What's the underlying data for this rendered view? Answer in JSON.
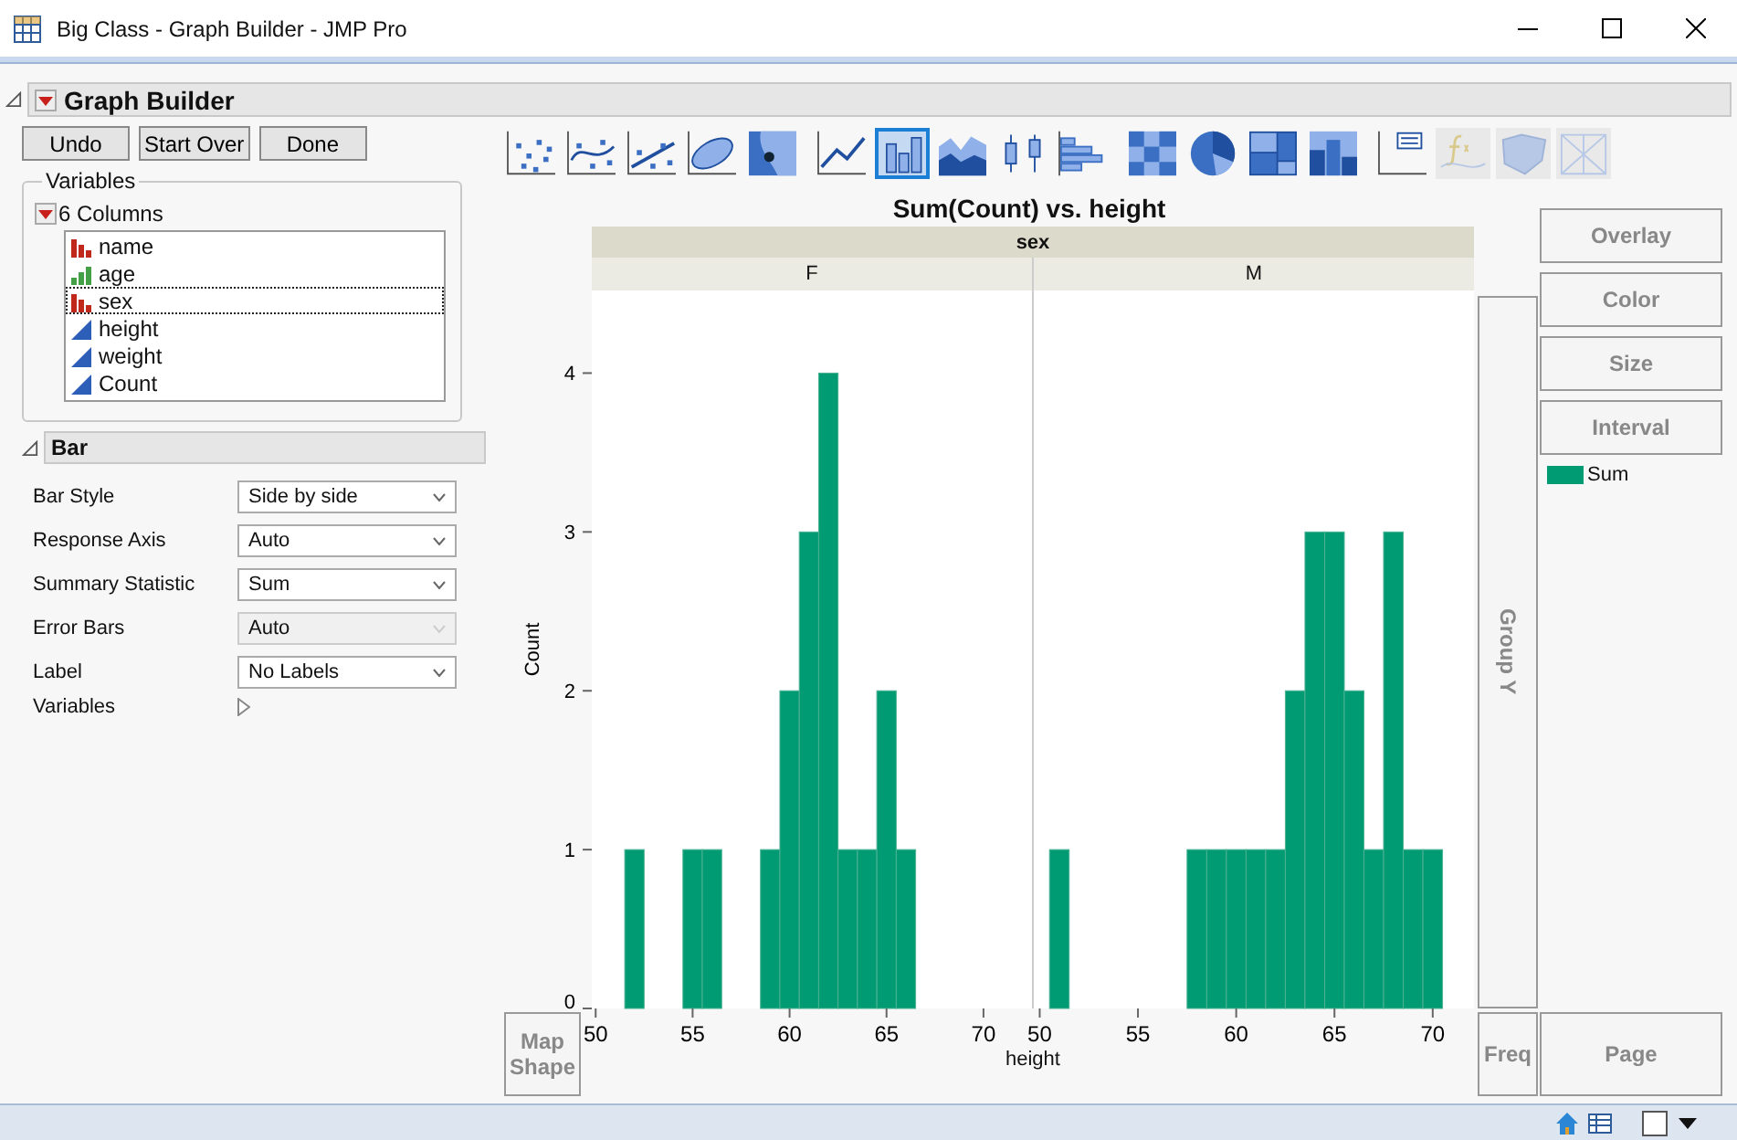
{
  "window": {
    "title": "Big Class - Graph Builder - JMP Pro"
  },
  "header": {
    "title": "Graph Builder"
  },
  "buttons": [
    "Undo",
    "Start Over",
    "Done"
  ],
  "variables": {
    "title": "Variables",
    "count_label": "6 Columns",
    "columns": [
      {
        "name": "name",
        "kind": "nominal",
        "selected": false
      },
      {
        "name": "age",
        "kind": "ordinal",
        "selected": false
      },
      {
        "name": "sex",
        "kind": "nominal",
        "selected": true
      },
      {
        "name": "height",
        "kind": "continuous",
        "selected": false
      },
      {
        "name": "weight",
        "kind": "continuous",
        "selected": false
      },
      {
        "name": "Count",
        "kind": "continuous",
        "selected": false
      }
    ]
  },
  "bar_section": {
    "title": "Bar",
    "options": [
      {
        "label": "Bar Style",
        "value": "Side by side",
        "disabled": false
      },
      {
        "label": "Response Axis",
        "value": "Auto",
        "disabled": false
      },
      {
        "label": "Summary Statistic",
        "value": "Sum",
        "disabled": false
      },
      {
        "label": "Error Bars",
        "value": "Auto",
        "disabled": true
      },
      {
        "label": "Label",
        "value": "No Labels",
        "disabled": false
      }
    ],
    "variables_label": "Variables"
  },
  "toolbar_groups": [
    {
      "items": [
        {
          "kind": "points",
          "selected": false,
          "disabled": false
        },
        {
          "kind": "smoother",
          "selected": false,
          "disabled": false
        },
        {
          "kind": "fit",
          "selected": false,
          "disabled": false
        },
        {
          "kind": "ellipse",
          "selected": false,
          "disabled": false
        },
        {
          "kind": "contour",
          "selected": false,
          "disabled": false
        }
      ]
    },
    {
      "items": [
        {
          "kind": "line",
          "selected": false,
          "disabled": false
        },
        {
          "kind": "bar",
          "selected": true,
          "disabled": false
        },
        {
          "kind": "area",
          "selected": false,
          "disabled": false
        },
        {
          "kind": "box",
          "selected": false,
          "disabled": false
        },
        {
          "kind": "histogram",
          "selected": false,
          "disabled": false
        }
      ]
    },
    {
      "items": [
        {
          "kind": "heatmap",
          "selected": false,
          "disabled": false
        },
        {
          "kind": "pie",
          "selected": false,
          "disabled": false
        },
        {
          "kind": "treemap",
          "selected": false,
          "disabled": false
        },
        {
          "kind": "mosaic",
          "selected": false,
          "disabled": false
        }
      ]
    },
    {
      "items": [
        {
          "kind": "caption",
          "selected": false,
          "disabled": false
        },
        {
          "kind": "formula",
          "selected": false,
          "disabled": true
        },
        {
          "kind": "map",
          "selected": false,
          "disabled": true
        },
        {
          "kind": "parallel",
          "selected": false,
          "disabled": true
        }
      ]
    }
  ],
  "graph": {
    "title": "Sum(Count) vs. height",
    "facet_title": "sex",
    "xlabel": "height",
    "facets": [
      {
        "label": "F",
        "chart_data": {
          "type": "bar",
          "ylabel": "Count",
          "x": [
            52,
            55,
            56,
            59,
            60,
            61,
            62,
            63,
            64,
            65,
            66
          ],
          "values": [
            1,
            1,
            1,
            1,
            2,
            3,
            4,
            1,
            1,
            2,
            1
          ],
          "xlim": [
            49.8,
            72.5
          ],
          "ylim": [
            0,
            4.52
          ],
          "xticks": [
            50,
            55,
            60,
            65,
            70
          ],
          "yticks": [
            0,
            1,
            2,
            3,
            4
          ]
        }
      },
      {
        "label": "M",
        "chart_data": {
          "type": "bar",
          "x": [
            51,
            58,
            59,
            60,
            61,
            62,
            63,
            64,
            65,
            66,
            67,
            68,
            69,
            70
          ],
          "values": [
            1,
            1,
            1,
            1,
            1,
            1,
            2,
            3,
            3,
            2,
            1,
            3,
            1,
            1
          ],
          "xlim": [
            49.7,
            72.1
          ],
          "ylim": [
            0,
            4.52
          ],
          "xticks": [
            50,
            55,
            60,
            65,
            70
          ]
        }
      }
    ],
    "drop_zones": {
      "group_y": "Group Y",
      "map_shape": "Map Shape",
      "freq": "Freq",
      "page": "Page",
      "right": [
        "Overlay",
        "Color",
        "Size",
        "Interval"
      ]
    },
    "legend": [
      {
        "label": "Sum",
        "color": "#009b72"
      }
    ]
  }
}
